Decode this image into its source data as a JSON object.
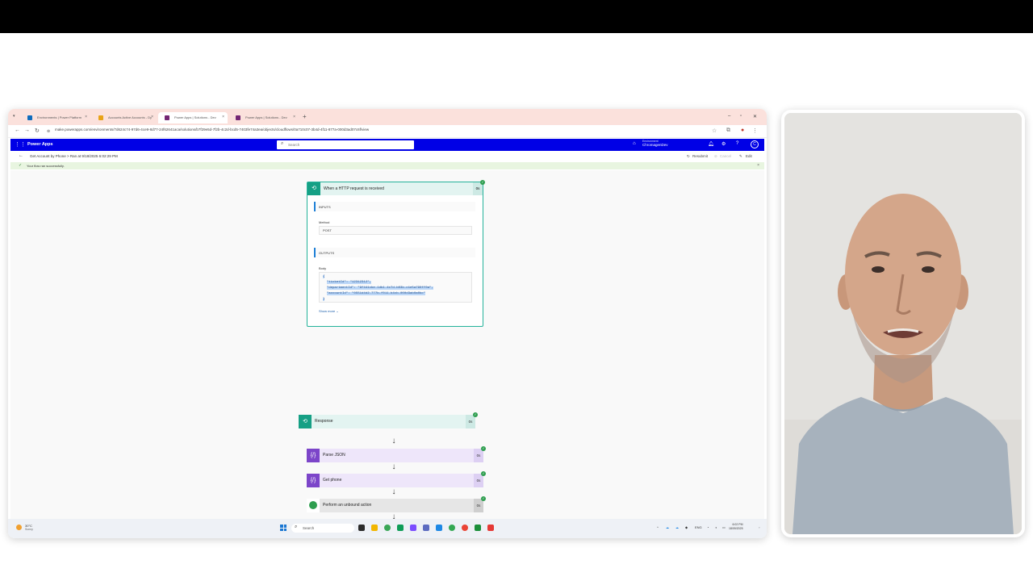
{
  "browser": {
    "tabs": [
      {
        "label": "Environments | Power Platform",
        "color": "#0f6cbd",
        "active": false
      },
      {
        "label": "Accounts Active Accounts - Dy",
        "color": "#e8a317",
        "active": false
      },
      {
        "label": "Power Apps | Solutions - Dev",
        "color": "#742774",
        "active": true
      },
      {
        "label": "Power Apps | Solutions - Dev",
        "color": "#742774",
        "active": false
      }
    ],
    "url": "make.powerapps.com/environments/7d624c74-97d6-4ce9-8d77-24f62641aca/solutions/b7f29e5d-7f2b-4c2d-bcd5-7403fe74a3ea/objects/cloudflows/0a710c07-3b4d-4f11-877a-000d3ad07c6f/view"
  },
  "appbar": {
    "title": "Power Apps",
    "search_placeholder": "Search",
    "environment_label": "Environment",
    "environment_name": "ChromagenDev",
    "avatar": "C"
  },
  "run": {
    "title": "Get Account by Phone > Ran at 9/18/2025 6:02:29 PM",
    "resubmit": "Resubmit",
    "cancel": "Cancel",
    "edit": "Edit",
    "banner": "Your flow ran successfully."
  },
  "trigger": {
    "name": "When a HTTP request is received",
    "duration": "0s",
    "inputs_title": "INPUTS",
    "method_label": "Method",
    "method_value": "POST",
    "outputs_title": "OUTPUTS",
    "body_label": "Body",
    "json_open": "{",
    "json_line1": "\"ticketId\": \"12312312\",",
    "json_line2": "\"departmentId\": \"9f441cbe-1db1-4c7d-b03b-c1e5a790ff0a\",",
    "json_line3": "\"accountId\": \"0551d4d2-777b-f011-b4cb-000d3ab0a0bc\"",
    "json_close": "}",
    "show_more": "Show more"
  },
  "steps": [
    {
      "name": "Parse JSON",
      "duration": "0s",
      "color": "#7c45c9",
      "bg": "#eee6fa"
    },
    {
      "name": "Get phone",
      "duration": "0s",
      "color": "#7c45c9",
      "bg": "#eee6fa"
    },
    {
      "name": "Perform an unbound action",
      "duration": "0s",
      "color": "#2e9e4f",
      "bg": "#e6e6e6"
    },
    {
      "name": "Response",
      "duration": "0s",
      "color": "#16a085",
      "bg": "#e3f4f1"
    }
  ],
  "taskbar": {
    "weather_temp": "30°C",
    "weather_desc": "Sunny",
    "search_placeholder": "Search",
    "lang": "ENG",
    "time": "6:02 PM",
    "date": "18/09/2025"
  }
}
